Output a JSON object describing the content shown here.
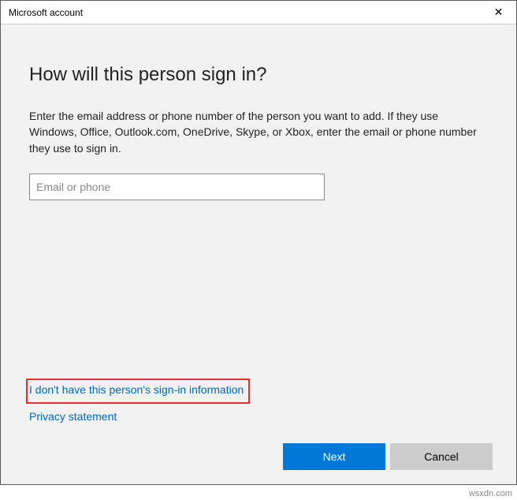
{
  "titlebar": {
    "title": "Microsoft account",
    "close_glyph": "✕"
  },
  "main": {
    "heading": "How will this person sign in?",
    "description": "Enter the email address or phone number of the person you want to add. If they use Windows, Office, Outlook.com, OneDrive, Skype, or Xbox, enter the email or phone number they use to sign in.",
    "email_placeholder": "Email or phone",
    "email_value": ""
  },
  "links": {
    "no_info": "I don't have this person's sign-in information",
    "privacy": "Privacy statement"
  },
  "footer": {
    "next": "Next",
    "cancel": "Cancel"
  },
  "watermark": "wsxdn.com"
}
